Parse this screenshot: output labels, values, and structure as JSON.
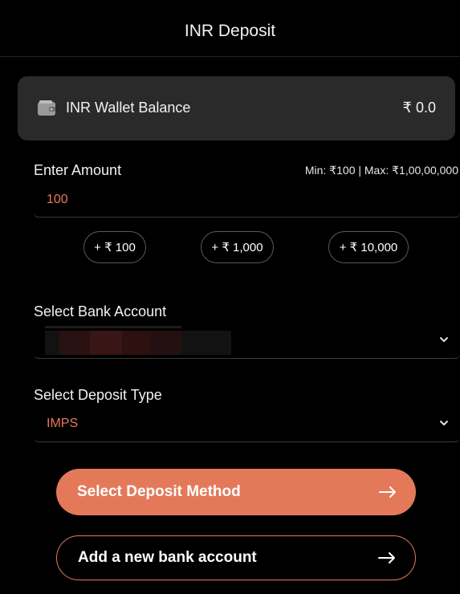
{
  "header": {
    "title": "INR Deposit"
  },
  "balance": {
    "icon": "wallet-icon",
    "label": "INR Wallet Balance",
    "value": "₹ 0.0"
  },
  "amount": {
    "label": "Enter Amount",
    "limits": "Min: ₹100 | Max: ₹1,00,00,000",
    "value": "100"
  },
  "quick_amounts": [
    "+ ₹ 100",
    "+ ₹ 1,000",
    "+ ₹ 10,000"
  ],
  "bank_account": {
    "label": "Select Bank Account",
    "icon": "chevron-down-icon"
  },
  "deposit_type": {
    "label": "Select Deposit Type",
    "value": "IMPS",
    "icon": "chevron-down-icon"
  },
  "buttons": {
    "primary": {
      "label": "Select Deposit Method",
      "icon": "arrow-right-icon"
    },
    "secondary": {
      "label": "Add a new bank account",
      "icon": "arrow-right-icon"
    }
  },
  "colors": {
    "accent": "#e4795a",
    "value_text": "#e8785a",
    "card": "#2a2a2a",
    "background": "#000000"
  }
}
